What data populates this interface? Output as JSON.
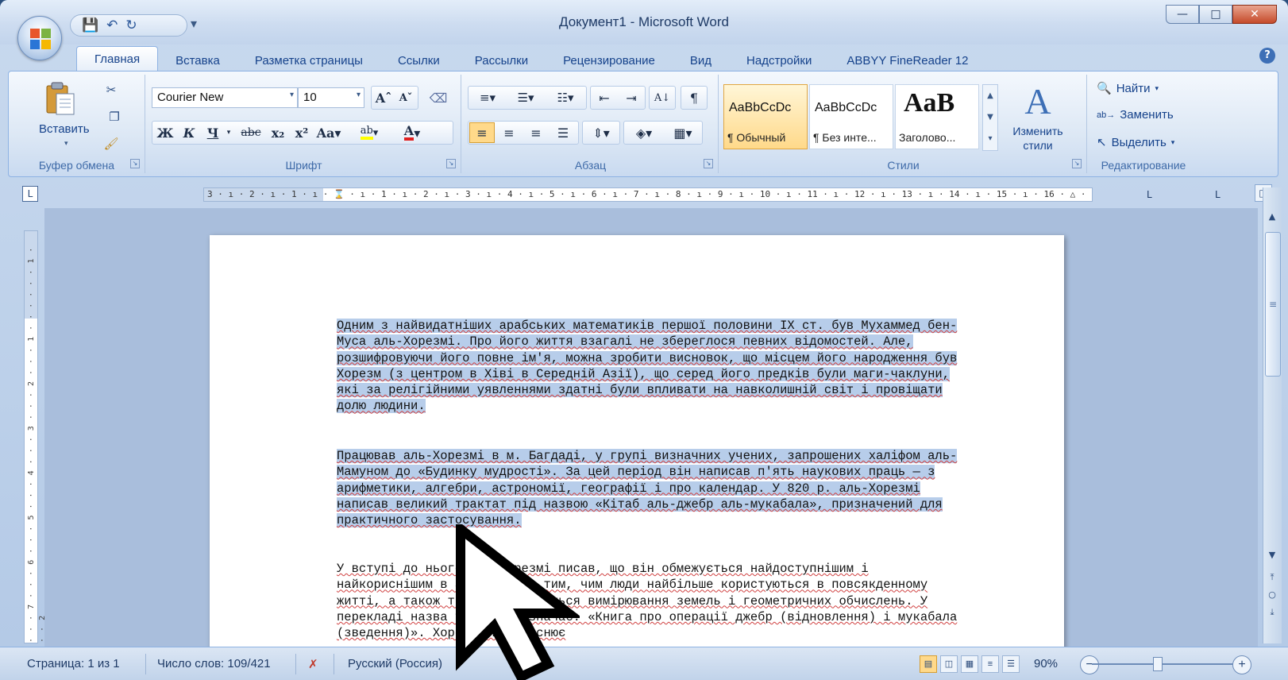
{
  "window": {
    "title": "Документ1 - Microsoft Word",
    "buttons": {
      "minimize": "—",
      "maximize": "□",
      "close": "✕"
    }
  },
  "qat": {
    "save_icon": "save-icon",
    "undo_icon": "undo-icon",
    "redo_icon": "redo-icon"
  },
  "tabs": [
    {
      "label": "Главная",
      "active": true
    },
    {
      "label": "Вставка"
    },
    {
      "label": "Разметка страницы"
    },
    {
      "label": "Ссылки"
    },
    {
      "label": "Рассылки"
    },
    {
      "label": "Рецензирование"
    },
    {
      "label": "Вид"
    },
    {
      "label": "Надстройки"
    },
    {
      "label": "ABBYY FineReader 12"
    }
  ],
  "ribbon": {
    "clipboard": {
      "label": "Буфер обмена",
      "paste": "Вставить"
    },
    "font": {
      "label": "Шрифт",
      "font_name": "Courier New",
      "font_size": "10"
    },
    "paragraph": {
      "label": "Абзац"
    },
    "styles": {
      "label": "Стили",
      "items": [
        {
          "sample": "AaBbCcDc",
          "name": "¶ Обычный"
        },
        {
          "sample": "AaBbCcDc",
          "name": "¶ Без инте..."
        },
        {
          "sample": "AaB",
          "name": "Заголово..."
        }
      ],
      "change": "Изменить стили"
    },
    "editing": {
      "label": "Редактирование",
      "find": "Найти",
      "replace": "Заменить",
      "select": "Выделить"
    }
  },
  "document": {
    "paragraphs": [
      "Одним з найвидатніших арабських математиків першої половини IX ст. був Мухаммед бен-Муса аль-Хорезмі. Про його життя взагалі не збереглося певних відомостей. Але, розшифровуючи його повне ім'я, можна зробити висновок, що місцем його народження був Хорезм (з центром в Хіві в Середній Азії), що серед його предків були маги-чаклуни, які за релігійними уявленнями здатні були впливати на навколишній світ і провіщати долю людини.",
      "Працював аль-Хорезмі в м. Багдаді, у групі визначних учених, запрошених халіфом аль-Мамуном до «Будинку мудрості». За цей період він написав п'ять наукових праць — з арифметики, алгебри, астрономії, географії і про календар. У 820 р. аль-Хорезмі написав великий трактат під назвою «Кітаб аль-джебр аль-мукабала», призначений для практичного застосування.",
      "У вступі до нього аль-Хорезмі писав, що він обмежується найдоступнішим і найкориснішим в арифметиці, тим, чим люди найбільше користуються в повсякденному житті, а також тим, що стосується вимірювання земель і геометричних обчислень. У перекладі назва трактату означає: «Книга про операції джебр (відновлення) і мукабала (зведення)». Хорезмі не пояснює"
    ],
    "selected_paragraphs": [
      0,
      1
    ]
  },
  "status": {
    "page": "Страница: 1 из 1",
    "words": "Число слов: 109/421",
    "language": "Русский (Россия)",
    "zoom": "90%"
  }
}
